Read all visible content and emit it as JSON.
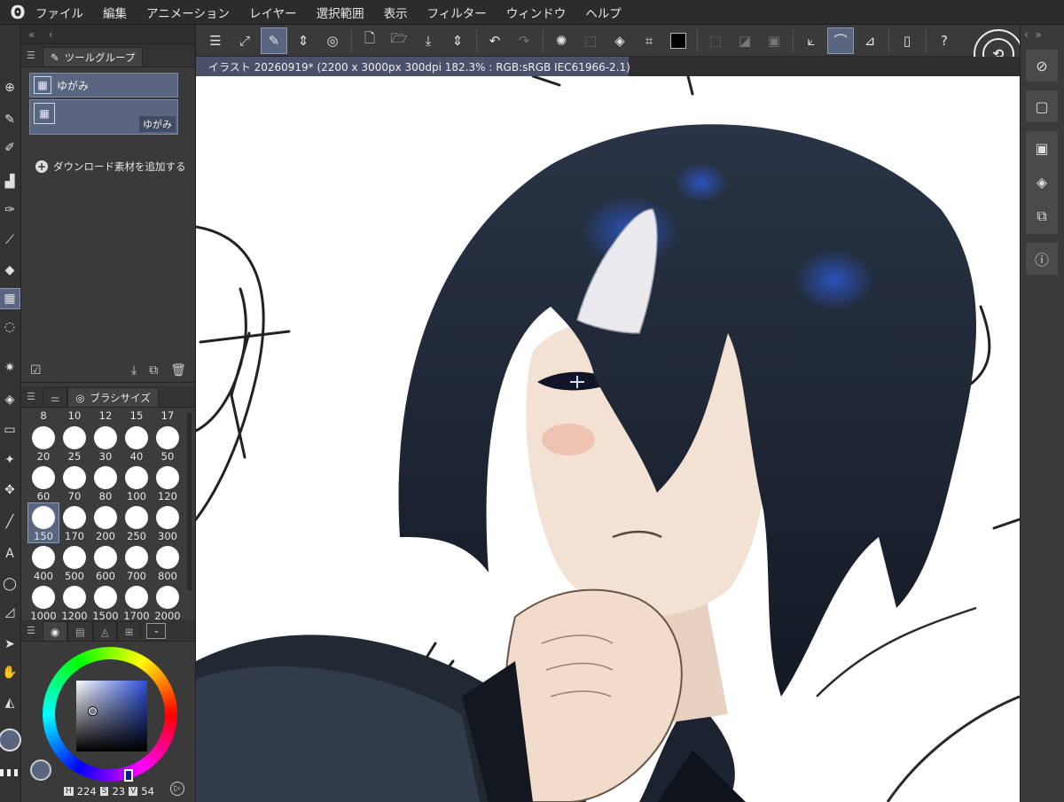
{
  "app": {
    "menu": [
      "ファイル",
      "編集",
      "アニメーション",
      "レイヤー",
      "選択範囲",
      "表示",
      "フィルター",
      "ウィンドウ",
      "ヘルプ"
    ]
  },
  "tool_panel": {
    "tab_label": "ツールグループ",
    "items": [
      {
        "label": "ゆがみ"
      },
      {
        "label": "ゆがみ"
      }
    ],
    "add_material": "ダウンロード素材を追加する"
  },
  "brush_size": {
    "tab_label": "ブラシサイズ",
    "top_row": [
      "8",
      "10",
      "12",
      "15",
      "17"
    ],
    "sizes": [
      "20",
      "25",
      "30",
      "40",
      "50",
      "60",
      "70",
      "80",
      "100",
      "120",
      "150",
      "170",
      "200",
      "250",
      "300",
      "400",
      "500",
      "600",
      "700",
      "800",
      "1000",
      "1200",
      "1500",
      "1700",
      "2000"
    ],
    "selected": "150"
  },
  "color": {
    "h_label": "H",
    "h": "224",
    "s_label": "S",
    "s": "23",
    "v_label": "V",
    "v": "54"
  },
  "document": {
    "tab_title": "イラスト 20260919* (2200 x 3000px 300dpi 182.3% : RGB:sRGB IEC61966-2.1)"
  },
  "colors": {
    "accent": "#5a6580",
    "panel": "#3a3a3a",
    "menubar": "#2c2c2c"
  }
}
